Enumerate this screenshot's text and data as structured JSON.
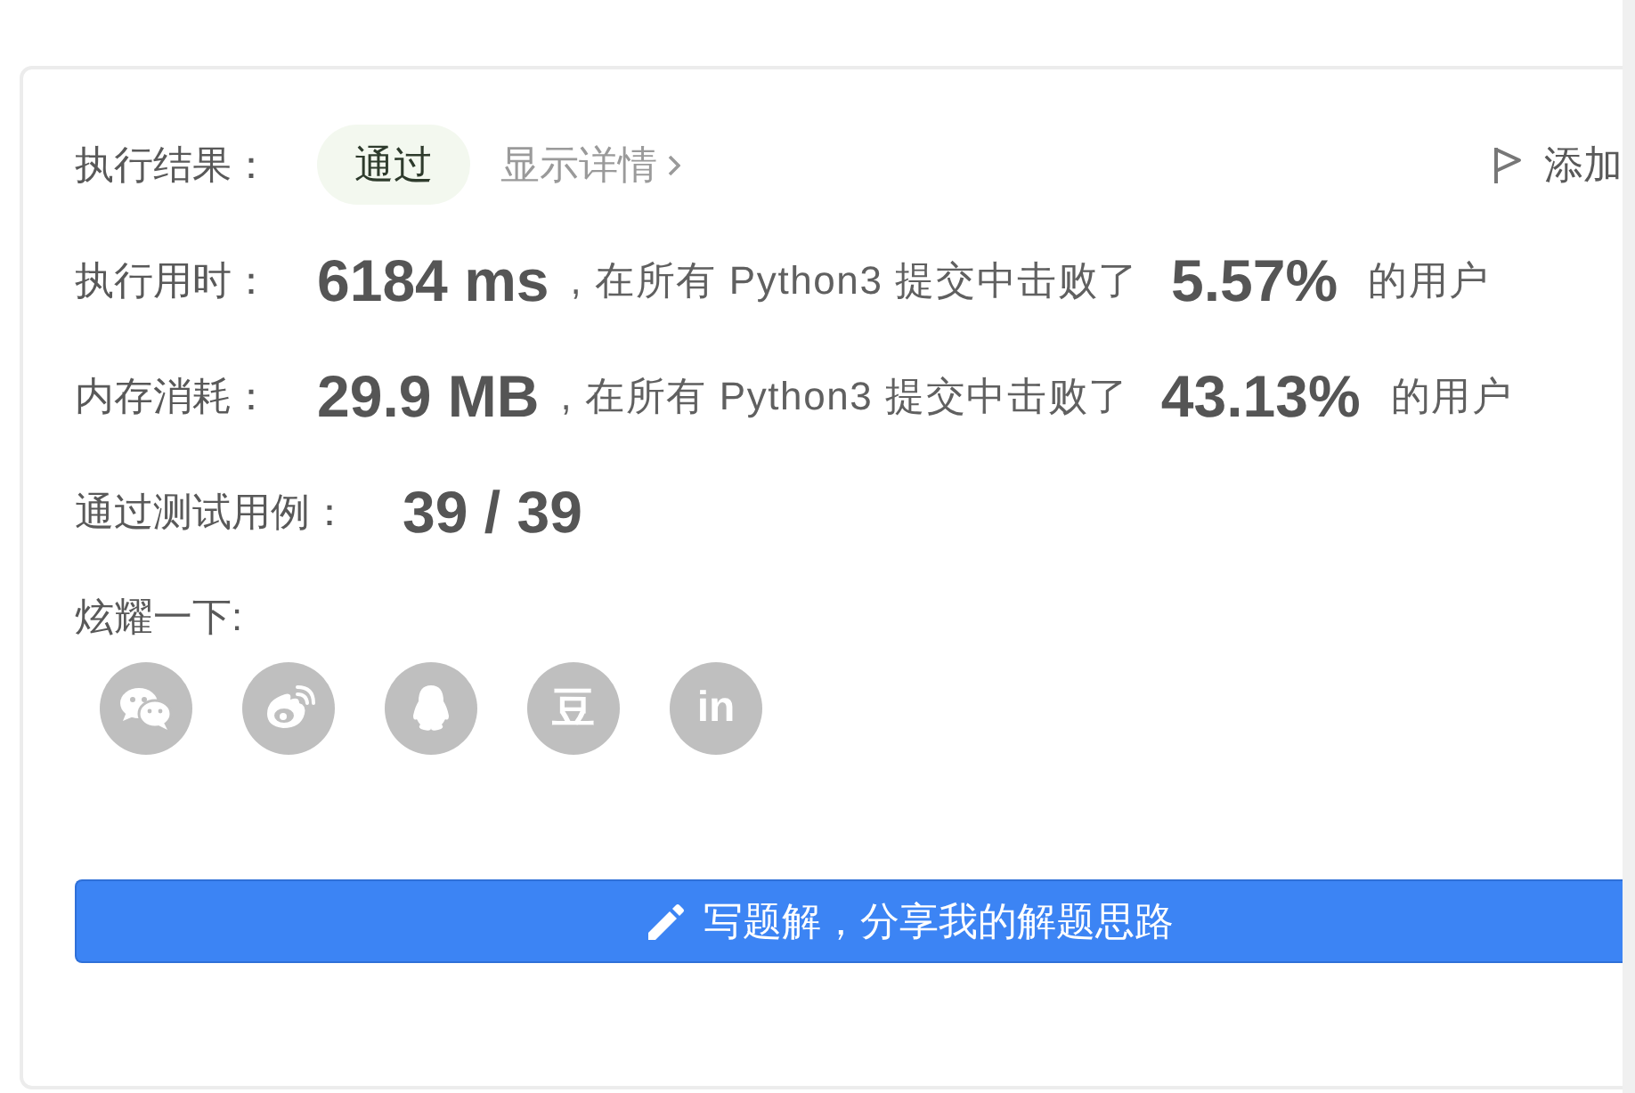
{
  "result": {
    "label": "执行结果：",
    "status": "通过",
    "details_link": "显示详情",
    "add_button": "添加"
  },
  "stats": [
    {
      "label": "执行用时：",
      "value": "6184 ms",
      "comparison": ", 在所有 Python3 提交中击败了",
      "percent": "5.57%",
      "suffix": "的用户"
    },
    {
      "label": "内存消耗：",
      "value": "29.9 MB",
      "comparison": ", 在所有 Python3 提交中击败了",
      "percent": "43.13%",
      "suffix": "的用户"
    }
  ],
  "test_cases": {
    "label": "通过测试用例：",
    "value": "39 / 39"
  },
  "share": {
    "label": "炫耀一下:",
    "buttons": [
      {
        "kind": "chat"
      },
      {
        "kind": "eye"
      },
      {
        "kind": "penguin"
      },
      {
        "kind": "glyph",
        "text": "豆"
      },
      {
        "kind": "glyph",
        "text": "in"
      }
    ]
  },
  "write_solution_button": "写题解，分享我的解题思路"
}
